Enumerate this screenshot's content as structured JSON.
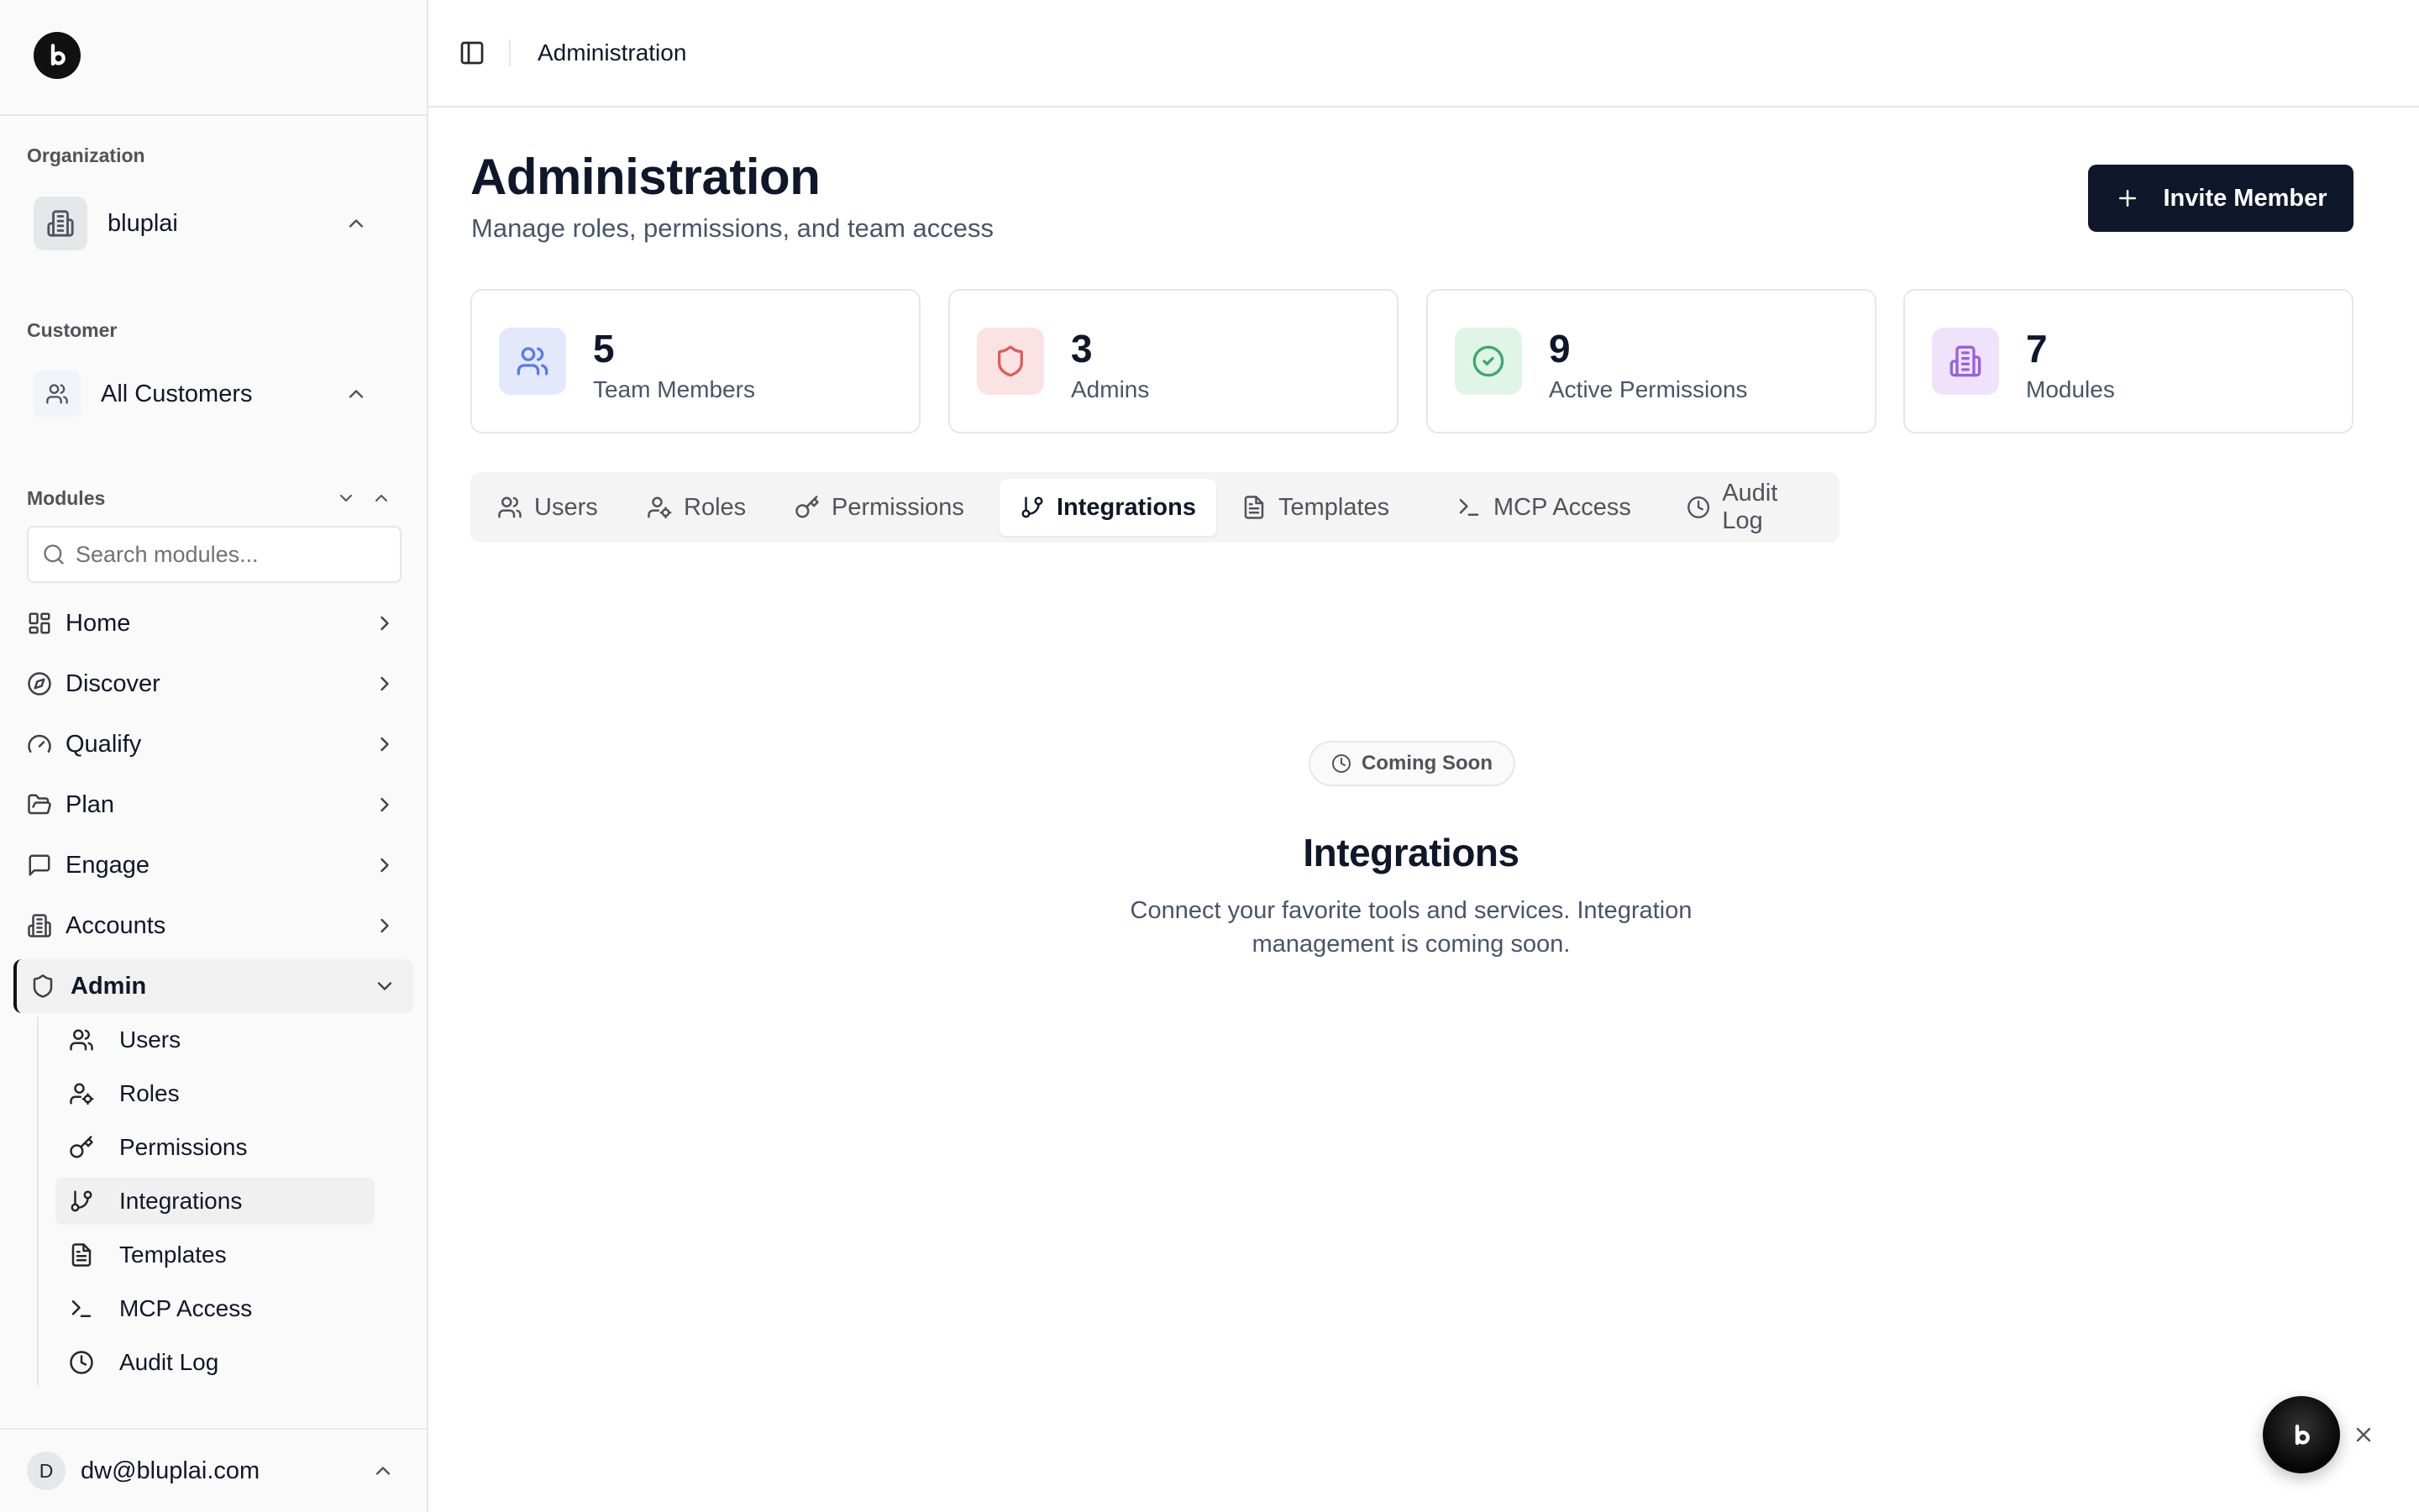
{
  "sidebar": {
    "organization_label": "Organization",
    "organization_name": "bluplai",
    "customer_label": "Customer",
    "customer_name": "All Customers",
    "modules_label": "Modules",
    "search_placeholder": "Search modules...",
    "nav": [
      {
        "label": "Home",
        "icon": "grid-icon"
      },
      {
        "label": "Discover",
        "icon": "compass-icon"
      },
      {
        "label": "Qualify",
        "icon": "gauge-icon"
      },
      {
        "label": "Plan",
        "icon": "folder-open-icon"
      },
      {
        "label": "Engage",
        "icon": "message-square-icon"
      },
      {
        "label": "Accounts",
        "icon": "building-icon"
      },
      {
        "label": "Admin",
        "icon": "shield-icon",
        "active": true
      }
    ],
    "admin_sub": [
      {
        "label": "Users",
        "icon": "users-icon"
      },
      {
        "label": "Roles",
        "icon": "user-cog-icon"
      },
      {
        "label": "Permissions",
        "icon": "key-icon"
      },
      {
        "label": "Integrations",
        "icon": "git-branch-icon",
        "active": true
      },
      {
        "label": "Templates",
        "icon": "file-text-icon"
      },
      {
        "label": "MCP Access",
        "icon": "terminal-icon"
      },
      {
        "label": "Audit Log",
        "icon": "clock-icon"
      }
    ],
    "user": {
      "initial": "D",
      "email": "dw@bluplai.com"
    }
  },
  "topbar": {
    "title": "Administration"
  },
  "main": {
    "title": "Administration",
    "subtitle": "Manage roles, permissions, and team access",
    "invite_label": "Invite Member",
    "stats": [
      {
        "value": "5",
        "label": "Team Members",
        "icon": "users-icon",
        "color": "#5b7be6",
        "bg": "#e3e9fb"
      },
      {
        "value": "3",
        "label": "Admins",
        "icon": "shield-icon",
        "color": "#e05b5b",
        "bg": "#fbe3e3"
      },
      {
        "value": "9",
        "label": "Active Permissions",
        "icon": "check-circle-icon",
        "color": "#3ea86b",
        "bg": "#e1f4e8"
      },
      {
        "value": "7",
        "label": "Modules",
        "icon": "building-icon",
        "color": "#9a5ee0",
        "bg": "#efe3fb"
      }
    ],
    "tabs": [
      {
        "label": "Users",
        "icon": "users-icon"
      },
      {
        "label": "Roles",
        "icon": "user-cog-icon"
      },
      {
        "label": "Permissions",
        "icon": "key-icon"
      },
      {
        "label": "Integrations",
        "icon": "git-branch-icon",
        "active": true
      },
      {
        "label": "Templates",
        "icon": "file-text-icon"
      },
      {
        "label": "MCP Access",
        "icon": "terminal-icon"
      },
      {
        "label": "Audit Log",
        "icon": "clock-icon"
      }
    ],
    "empty_state": {
      "badge": "Coming Soon",
      "title": "Integrations",
      "description": "Connect your favorite tools and services. Integration management is coming soon."
    }
  }
}
